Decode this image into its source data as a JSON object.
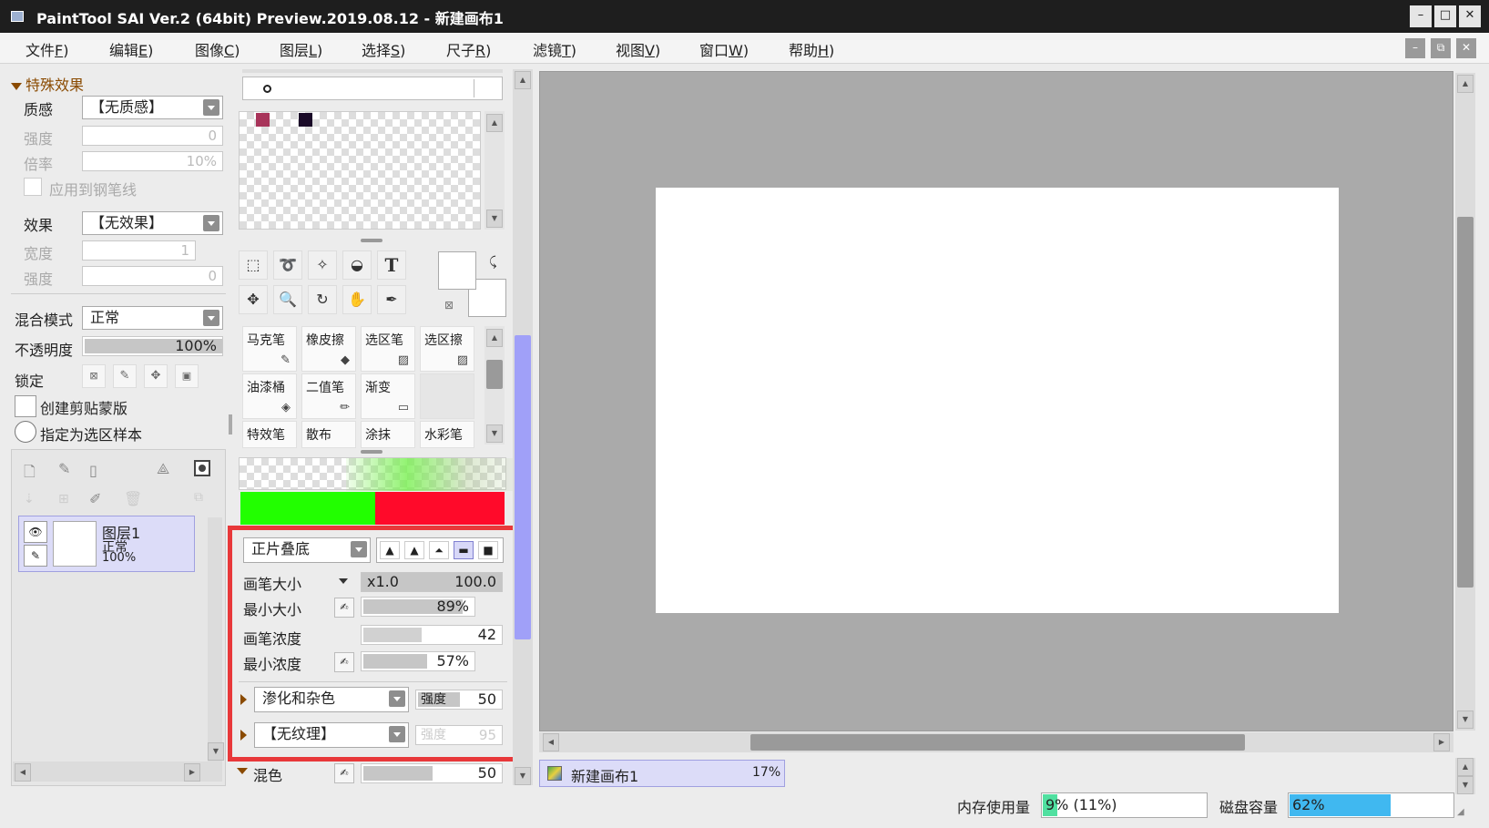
{
  "window": {
    "title": "PaintTool SAI Ver.2 (64bit) Preview.2019.08.12 - 新建画布1",
    "min": "–",
    "max": "□",
    "close": "✕",
    "mdi_min": "–",
    "mdi_restore": "⧉",
    "mdi_close": "✕"
  },
  "menu": [
    {
      "label": "文件",
      "key": "F"
    },
    {
      "label": "编辑",
      "key": "E"
    },
    {
      "label": "图像",
      "key": "C"
    },
    {
      "label": "图层",
      "key": "L"
    },
    {
      "label": "选择",
      "key": "S"
    },
    {
      "label": "尺子",
      "key": "R"
    },
    {
      "label": "滤镜",
      "key": "T"
    },
    {
      "label": "视图",
      "key": "V"
    },
    {
      "label": "窗口",
      "key": "W"
    },
    {
      "label": "帮助",
      "key": "H"
    }
  ],
  "effects": {
    "header": "特殊效果",
    "texture_label": "质感",
    "texture_value": "【无质感】",
    "strength_label": "强度",
    "strength_value": "0",
    "rate_label": "倍率",
    "rate_value": "10%",
    "apply_pen": "应用到钢笔线",
    "effect_label": "效果",
    "effect_value": "【无效果】",
    "width_label": "宽度",
    "width_value": "1",
    "strength2_label": "强度",
    "strength2_value": "0"
  },
  "layer_props": {
    "blend_label": "混合模式",
    "blend_value": "正常",
    "opacity_label": "不透明度",
    "opacity_value": "100%",
    "opacity_level": 1.0,
    "lock_label": "锁定",
    "clip_label": "创建剪贴蒙版",
    "sample_label": "指定为选区样本"
  },
  "layer": {
    "name": "图层1",
    "mode": "正常",
    "opacity": "100%"
  },
  "tools": {
    "text_tool": "T"
  },
  "brushes": [
    "马克笔",
    "橡皮擦",
    "选区笔",
    "选区擦",
    "油漆桶",
    "二值笔",
    "渐变",
    "",
    "特效笔",
    "散布",
    "涂抹",
    "水彩笔"
  ],
  "brush_settings": {
    "blend": "正片叠底",
    "size_label": "画笔大小",
    "size_mult": "x1.0",
    "size_value": "100.0",
    "min_size_label": "最小大小",
    "min_size_value": "89%",
    "min_size_level": 0.89,
    "density_label": "画笔浓度",
    "density_value": "42",
    "density_level": 0.42,
    "min_density_label": "最小浓度",
    "min_density_value": "57%",
    "min_density_level": 0.57,
    "mix_value": "渗化和杂色",
    "mix_strength_label": "强度",
    "mix_strength_value": "50",
    "mix_level": 0.5,
    "texture_value": "【无纹理】",
    "tex_strength_label": "强度",
    "tex_strength_value": "95",
    "blur_label": "混色",
    "blur_value": "50",
    "blur_level": 0.5
  },
  "colors": {
    "swatch1": "#a8345a",
    "swatch2": "#1a0a28",
    "green": "#22ff00",
    "red": "#ff0a2a",
    "highlight": "#e8383a",
    "layer_sel": "#dcdcf8",
    "accent_blue": "#a0a0f8"
  },
  "canvas_tab": {
    "name": "新建画布1",
    "zoom": "17%"
  },
  "status": {
    "mem_label": "内存使用量",
    "mem_value": "9% (11%)",
    "mem_level": 0.09,
    "disk_label": "磁盘容量",
    "disk_value": "62%",
    "disk_level": 0.62
  }
}
